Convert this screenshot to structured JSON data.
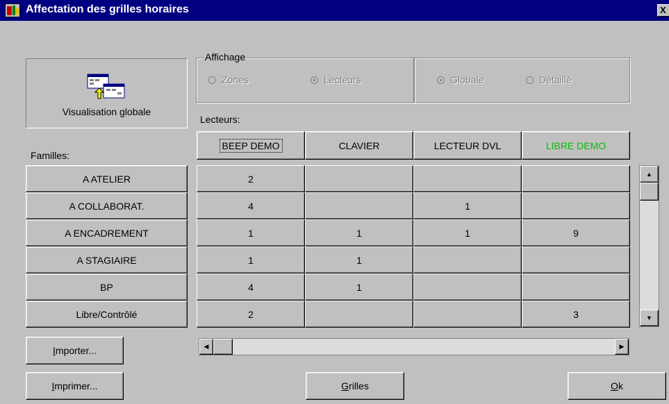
{
  "window": {
    "title": "Affectation des grilles horaires",
    "close": "X"
  },
  "view_button": {
    "label": "Visualisation globale"
  },
  "affichage": {
    "legend": "Affichage",
    "option_zones": "Zones",
    "option_lecteurs": "Lecteurs",
    "option_globale": "Globale",
    "option_detaille": "Détaillé"
  },
  "labels": {
    "lecteurs": "Lecteurs:",
    "familles": "Familles:"
  },
  "readers": [
    "BEEP DEMO",
    "CLAVIER",
    "LECTEUR DVL",
    "LIBRE DEMO"
  ],
  "reader_colors": [
    "#000000",
    "#000000",
    "#000000",
    "#00c000"
  ],
  "families": [
    "A ATELIER",
    "A COLLABORAT.",
    "A ENCADREMENT",
    "A STAGIAIRE",
    "BP",
    "Libre/Contrôlé"
  ],
  "grid": [
    [
      "2",
      "",
      "",
      ""
    ],
    [
      "4",
      "",
      "1",
      ""
    ],
    [
      "1",
      "1",
      "1",
      "9"
    ],
    [
      "1",
      "1",
      "",
      ""
    ],
    [
      "4",
      "1",
      "",
      ""
    ],
    [
      "2",
      "",
      "",
      "3"
    ]
  ],
  "buttons": {
    "importer": {
      "first": "I",
      "rest": "mporter..."
    },
    "imprimer": {
      "first": "I",
      "rest": "mprimer..."
    },
    "grilles": {
      "first": "G",
      "rest": "rilles"
    },
    "ok": {
      "first": "O",
      "rest": "k"
    }
  }
}
